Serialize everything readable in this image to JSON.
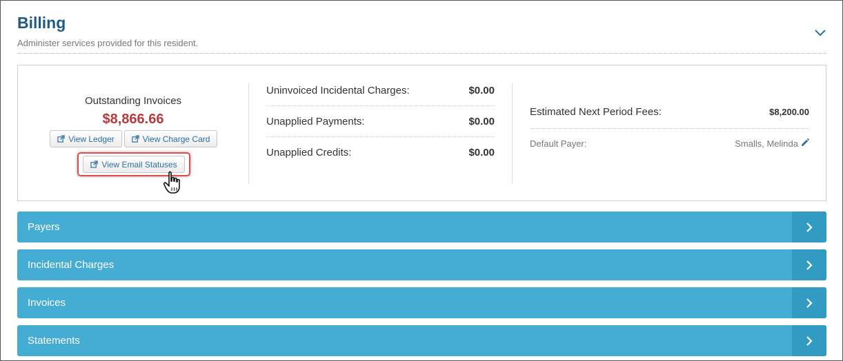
{
  "section": {
    "title": "Billing",
    "subtitle": "Administer services provided for this resident."
  },
  "summary": {
    "outstanding_label": "Outstanding Invoices",
    "outstanding_value": "$8,866.66",
    "buttons": {
      "ledger": "View Ledger",
      "charge_card": "View Charge Card",
      "email_statuses": "View Email Statuses"
    },
    "middle": [
      {
        "label": "Uninvoiced Incidental Charges:",
        "value": "$0.00"
      },
      {
        "label": "Unapplied Payments:",
        "value": "$0.00"
      },
      {
        "label": "Unapplied Credits:",
        "value": "$0.00"
      }
    ],
    "estimated_label": "Estimated Next Period Fees:",
    "estimated_value": "$8,200.00",
    "default_payer_label": "Default Payer:",
    "default_payer_value": "Smalls, Melinda"
  },
  "accordions": [
    {
      "label": "Payers"
    },
    {
      "label": "Incidental Charges"
    },
    {
      "label": "Invoices"
    },
    {
      "label": "Statements"
    }
  ],
  "icons": {
    "collapse": "chevron-down-icon",
    "external": "external-link-icon",
    "edit": "pencil-icon",
    "expand": "chevron-right-icon",
    "cursor": "hand-pointer-icon"
  },
  "colors": {
    "title": "#1f5a84",
    "amount_due": "#b8393b",
    "accordion": "#45acd3",
    "accordion_chevron_bg": "#329bc4",
    "highlight": "#e04a4a",
    "link": "#2a6fa5"
  }
}
